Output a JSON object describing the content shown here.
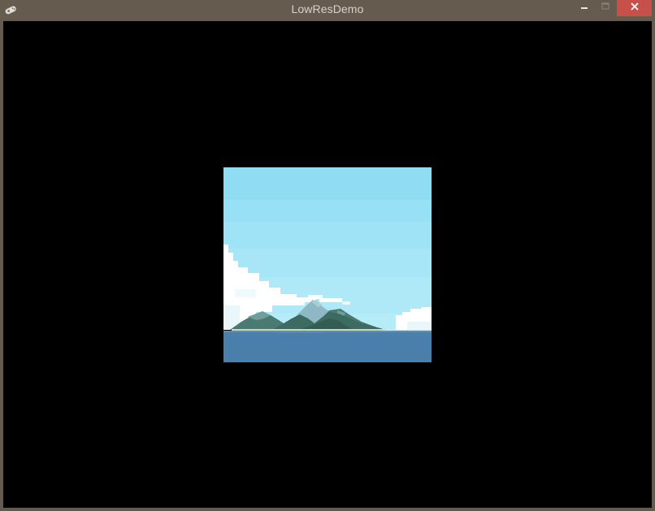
{
  "window": {
    "title": "LowResDemo",
    "app_icon": "gamepad-icon",
    "controls": [
      "minimize-icon",
      "maximize-icon",
      "close-icon"
    ],
    "colors": {
      "titlebar": "#655b4f",
      "title_text": "#d8d2ca",
      "close_button": "#c7504a",
      "canvas_background": "#000000"
    }
  },
  "scene": {
    "description_icon": "island-scene",
    "colors": {
      "sky_top": "#8fdcf3",
      "sky_bottom": "#b6ebf8",
      "sea": "#4a7fab",
      "mountain_dark": "#3f6b62",
      "mountain_light": "#6d9a9e",
      "cloud": "#ffffff"
    }
  }
}
